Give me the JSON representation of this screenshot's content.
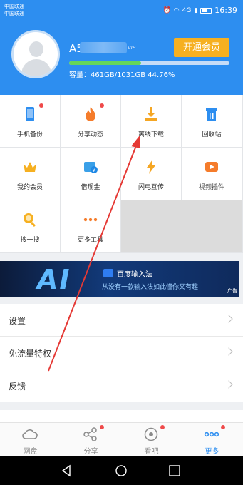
{
  "status_bar": {
    "carrier_1": "中国联通",
    "carrier_2": "中国联通",
    "network": "4G",
    "time": "16:39"
  },
  "profile": {
    "username_prefix": "A5",
    "vip_badge": "VIP",
    "vip_button": "开通会员",
    "storage_text": "容量：461GB/1031GB 44.76%",
    "storage_fraction": 0.4476
  },
  "grid": {
    "items": [
      {
        "label": "手机备份",
        "icon": "phone-backup-icon"
      },
      {
        "label": "分享动态",
        "icon": "flame-icon"
      },
      {
        "label": "离线下载",
        "icon": "download-icon"
      },
      {
        "label": "回收站",
        "icon": "trash-icon"
      },
      {
        "label": "我的会员",
        "icon": "crown-icon"
      },
      {
        "label": "借现金",
        "icon": "cash-icon"
      },
      {
        "label": "闪电互传",
        "icon": "lightning-icon"
      },
      {
        "label": "视频插件",
        "icon": "video-plugin-icon"
      },
      {
        "label": "搜一搜",
        "icon": "search-icon"
      },
      {
        "label": "更多工具",
        "icon": "more-dots-icon"
      }
    ]
  },
  "banner": {
    "big_text": "AI",
    "title": "百度输入法",
    "subtitle": "从没有一款输入法如此懂你又有趣",
    "ad_label": "广告"
  },
  "settings": {
    "items": [
      {
        "label": "设置"
      },
      {
        "label": "免流量特权"
      },
      {
        "label": "反馈"
      }
    ]
  },
  "bottom_nav": {
    "items": [
      {
        "label": "网盘",
        "icon": "cloud-icon"
      },
      {
        "label": "分享",
        "icon": "share-icon"
      },
      {
        "label": "看吧",
        "icon": "eye-icon"
      },
      {
        "label": "更多",
        "icon": "more-icon"
      }
    ],
    "active": "更多"
  },
  "colors": {
    "primary": "#2d8ef0",
    "vip": "#f6b021",
    "progress": "#65d659",
    "badge": "#ef4a4a",
    "annotation": "#e53935"
  }
}
